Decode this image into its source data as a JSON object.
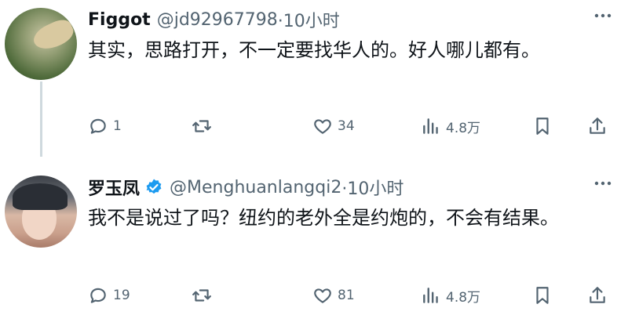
{
  "tweets": [
    {
      "name": "Figgot",
      "verified": false,
      "handle": "@jd92967798",
      "time": "·10小时",
      "text": "其实，思路打开，不一定要找华人的。好人哪儿都有。",
      "replies": "1",
      "retweets": "",
      "likes": "34",
      "views": "4.8万"
    },
    {
      "name": "罗玉凤",
      "verified": true,
      "handle": "@Menghuanlangqi2",
      "time": "·10小时",
      "text": "我不是说过了吗？纽约的老外全是约炮的，不会有结果。",
      "replies": "19",
      "retweets": "",
      "likes": "81",
      "views": "4.8万"
    }
  ],
  "colors": {
    "text": "#0f1419",
    "muted": "#536471",
    "verified": "#1d9bf0",
    "thread_line": "#cfd9de"
  },
  "icons": [
    "reply-icon",
    "retweet-icon",
    "like-icon",
    "views-icon",
    "bookmark-icon",
    "share-icon",
    "more-icon",
    "verified-badge-icon"
  ]
}
